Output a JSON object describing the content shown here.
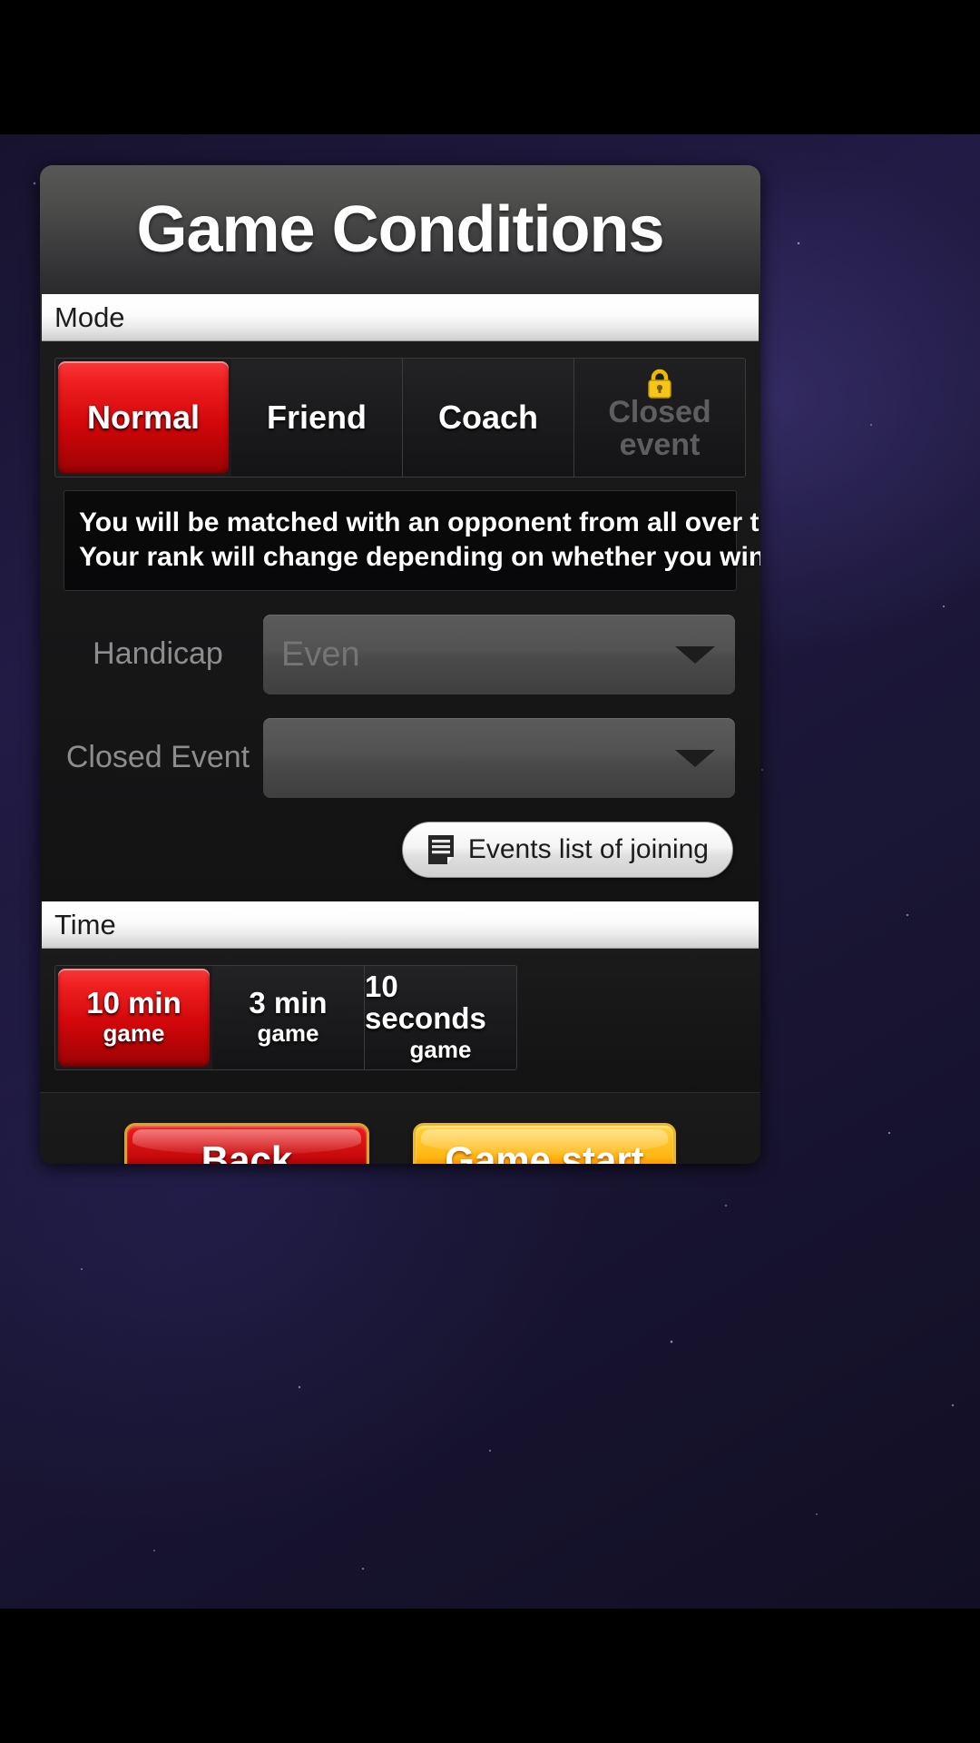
{
  "header": {
    "title": "Game Conditions"
  },
  "sections": {
    "mode": {
      "bar_label": "Mode",
      "tabs": [
        {
          "label": "Normal",
          "selected": true,
          "locked": false
        },
        {
          "label": "Friend",
          "selected": false,
          "locked": false
        },
        {
          "label": "Coach",
          "selected": false,
          "locked": false
        },
        {
          "label": "Closed event",
          "selected": false,
          "locked": true,
          "icon": "lock-icon"
        }
      ],
      "description": {
        "line1": "You will be matched with an opponent from all over the world.",
        "line2": "Your rank will change depending on whether you win or lose."
      },
      "fields": [
        {
          "label": "Handicap",
          "value": "Even",
          "caret": "chevron-down-icon"
        },
        {
          "label": "Closed Event",
          "value": "",
          "caret": "chevron-down-icon"
        }
      ],
      "events_button": {
        "label": "Events list of joining",
        "icon": "document-list-icon"
      }
    },
    "time": {
      "bar_label": "Time",
      "tabs": [
        {
          "main": "10 min",
          "sub": "game",
          "selected": true
        },
        {
          "main": "3 min",
          "sub": "game",
          "selected": false
        },
        {
          "main": "10 seconds",
          "sub": "game",
          "selected": false
        }
      ]
    }
  },
  "footer": {
    "back_label": "Back",
    "start_label": "Game start"
  },
  "colors": {
    "accent_red": "#ef1f20",
    "accent_gold": "#ffb715",
    "lock_yellow": "#f5c518",
    "panel_dark": "#17171a",
    "bar_white": "#ffffff"
  }
}
